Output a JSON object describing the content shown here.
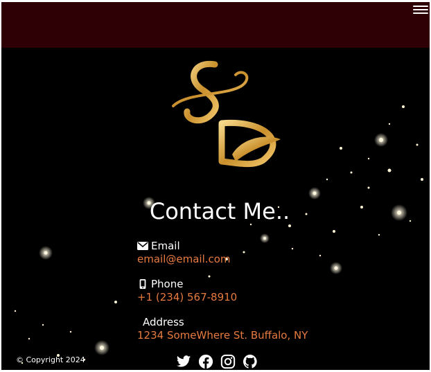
{
  "header": {
    "menu_icon": "hamburger-menu-icon",
    "background": "#2e0005"
  },
  "logo": {
    "letters": "SD",
    "color": "#d9a440"
  },
  "contact": {
    "title": "Contact Me..",
    "email": {
      "icon": "envelope-icon",
      "label": "Email",
      "value": "email@email.com"
    },
    "phone": {
      "icon": "mobile-phone-icon",
      "label": "Phone",
      "value": "+1 (234) 567-8910"
    },
    "address": {
      "label": "Address",
      "value": "1234 SomeWhere St. Buffalo, NY"
    }
  },
  "footer": {
    "copyright": "© Copyright 2024",
    "socials": [
      {
        "icon": "twitter-icon"
      },
      {
        "icon": "facebook-icon"
      },
      {
        "icon": "instagram-icon"
      },
      {
        "icon": "github-icon"
      }
    ]
  },
  "colors": {
    "background": "#000000",
    "accent": "#e77a3e",
    "text": "#ffffff"
  }
}
